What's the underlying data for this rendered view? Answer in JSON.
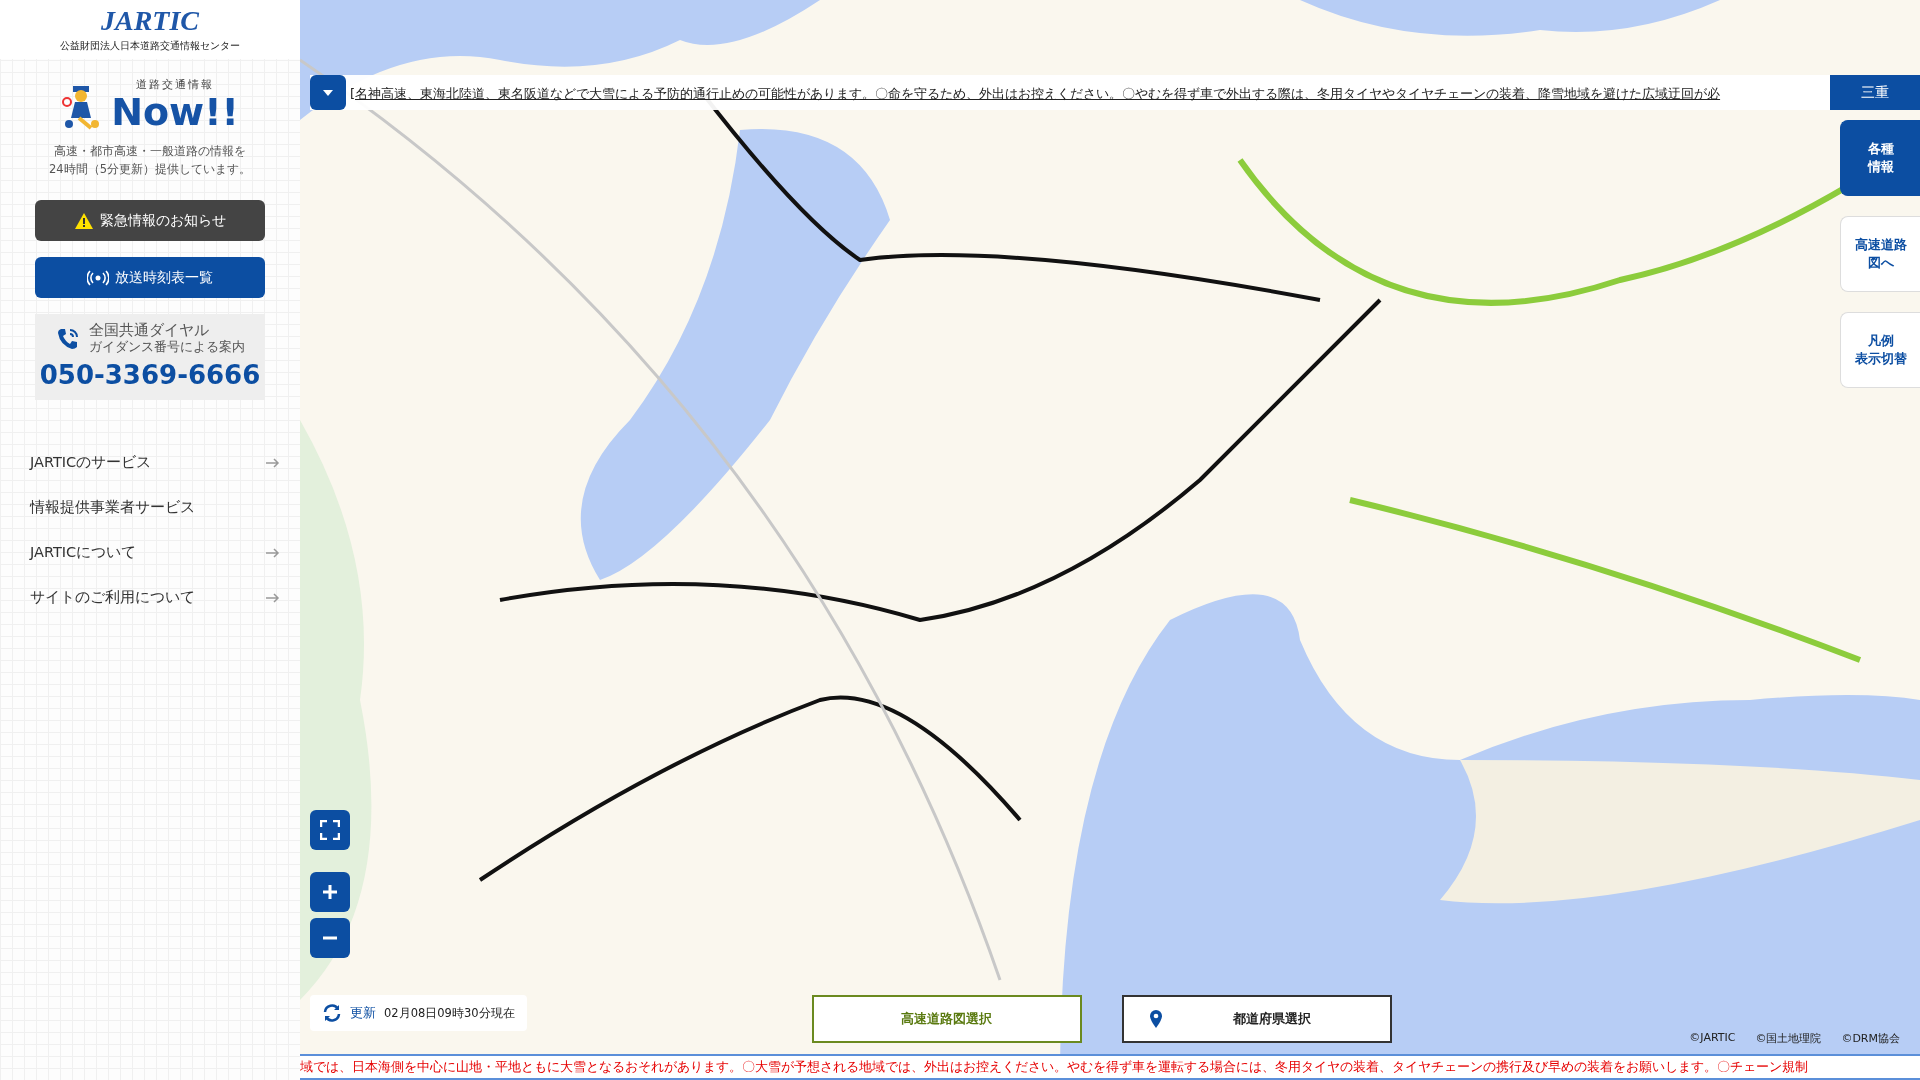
{
  "sidebar": {
    "logo": "JARTIC",
    "org": "公益財団法人日本道路交通情報センター",
    "brand_small": "道路交通情報",
    "brand": "Now!!",
    "tagline": "高速・都市高速・一般道路の情報を\n24時間（5分更新）提供しています。",
    "buttons": [
      {
        "kind": "alert",
        "label": "緊急情報のお知らせ"
      },
      {
        "kind": "broadcast",
        "label": "放送時刻表一覧"
      }
    ],
    "dial": {
      "title": "全国共通ダイヤル",
      "subtitle": "ガイダンス番号による案内",
      "number": "050-3369-6666"
    },
    "menu": [
      {
        "label": "JARTICのサービス",
        "arrow": true
      },
      {
        "label": "情報提供事業者サービス",
        "arrow": false
      },
      {
        "label": "JARTICについて",
        "arrow": true
      },
      {
        "label": "サイトのご利用について",
        "arrow": true
      }
    ]
  },
  "ticker_top": {
    "text": "[名神高速、東海北陸道、東名阪道などで大雪による予防的通行止めの可能性があります。〇命を守るため、外出はお控えください。〇やむを得ず車で外出する際は、冬用タイヤやタイヤチェーンの装着、降雪地域を避けた広域迂回が必",
    "region": "三重"
  },
  "side_buttons": [
    {
      "lines": [
        "各種",
        "情報"
      ],
      "selected": true
    },
    {
      "lines": [
        "高速道路",
        "図へ"
      ],
      "selected": false
    },
    {
      "lines": [
        "凡例",
        "表示切替"
      ],
      "selected": false
    }
  ],
  "update": {
    "label": "更新",
    "time": "02月08日09時30分現在"
  },
  "bottom_buttons": [
    {
      "kind": "highway",
      "label": "高速道路図選択"
    },
    {
      "kind": "pref",
      "label": "都道府県選択"
    }
  ],
  "credits": [
    "©JARTIC",
    "©国土地理院",
    "©DRM協会"
  ],
  "ticker_bottom": "域では、日本海側を中心に山地・平地ともに大雪となるおそれがあります。〇大雪が予想される地域では、外出はお控えください。やむを得ず車を運転する場合には、冬用タイヤの装着、タイヤチェーンの携行及び早めの装着をお願いします。〇チェーン規制"
}
